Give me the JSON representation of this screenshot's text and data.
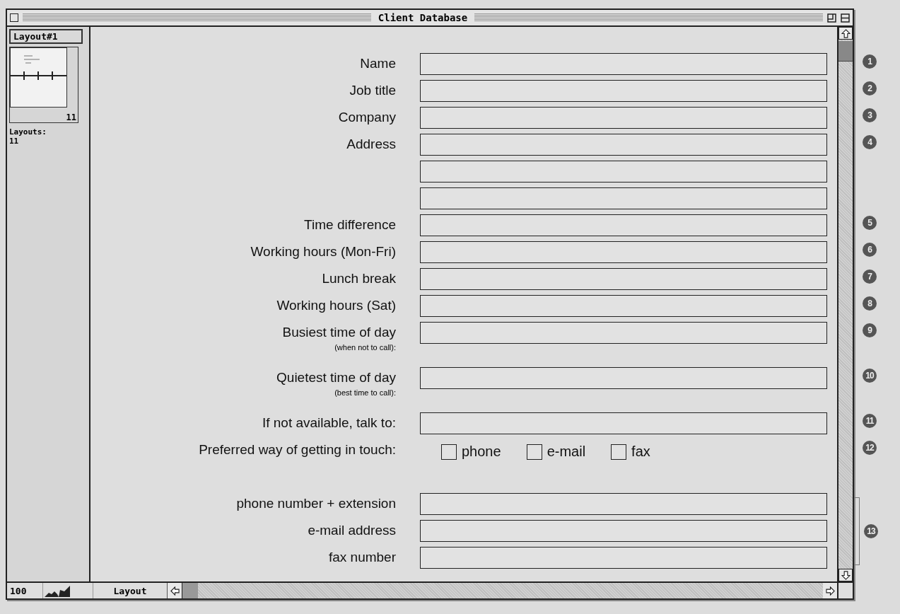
{
  "window": {
    "title": "Client Database"
  },
  "sidebar": {
    "tab": "Layout#1",
    "page_count": "11",
    "layouts_label": "Layouts:",
    "layouts_count": "11"
  },
  "form": {
    "rows": [
      {
        "kind": "field",
        "label": "Name",
        "callout": "1"
      },
      {
        "kind": "field",
        "label": "Job title",
        "callout": "2"
      },
      {
        "kind": "field",
        "label": "Company",
        "callout": "3"
      },
      {
        "kind": "field",
        "label": "Address",
        "callout": "4"
      },
      {
        "kind": "field"
      },
      {
        "kind": "field"
      },
      {
        "kind": "field",
        "label": "Time difference",
        "callout": "5"
      },
      {
        "kind": "field",
        "label": "Working hours (Mon-Fri)",
        "callout": "6"
      },
      {
        "kind": "field",
        "label": "Lunch break",
        "callout": "7"
      },
      {
        "kind": "field",
        "label": "Working hours (Sat)",
        "callout": "8"
      },
      {
        "kind": "noted",
        "label": "Busiest time of day",
        "note": "(when not to call):",
        "callout": "9"
      },
      {
        "kind": "noted",
        "label": "Quietest time of day",
        "note": "(best time to call):",
        "callout": "10"
      },
      {
        "kind": "field",
        "label": "If not available, talk to:",
        "callout": "11"
      },
      {
        "kind": "choice",
        "label": "Preferred way of getting in touch:",
        "callout": "12",
        "options": [
          {
            "label": "phone",
            "checked": false
          },
          {
            "label": "e-mail",
            "checked": false
          },
          {
            "label": "fax",
            "checked": false
          }
        ]
      }
    ],
    "contact": {
      "callout": "13",
      "rows": [
        {
          "label": "phone number + extension"
        },
        {
          "label": "e-mail address"
        },
        {
          "label": "fax number"
        }
      ]
    }
  },
  "status_bar": {
    "zoom": "100",
    "mode": "Layout"
  }
}
